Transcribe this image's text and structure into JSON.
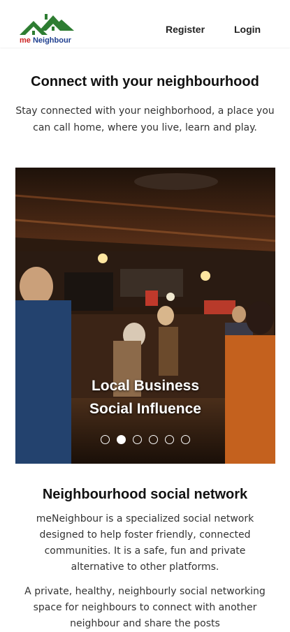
{
  "header": {
    "logo_prefix": "me",
    "logo_name": "Neighbour",
    "register_label": "Register",
    "login_label": "Login"
  },
  "hero": {
    "title": "Connect with your neighbourhood",
    "subtitle": "Stay connected with your neighborhood, a place you can call home, where you live, learn and play."
  },
  "carousel": {
    "caption_line1": "Local Business",
    "caption_line2": "Social Influence",
    "slide_count": 6,
    "active_index": 1
  },
  "about": {
    "title": "Neighbourhood social network",
    "paragraph1": "meNeighbour is a specialized social network designed to help foster friendly, connected communities. It is a safe, fun and private alternative to other platforms.",
    "paragraph2": "A private, healthy, neighbourly social networking space for neighbours to connect with another neighbour and share the posts"
  },
  "colors": {
    "logo_green": "#2e7d32",
    "logo_red": "#cc2222",
    "logo_blue": "#1f3f8f"
  }
}
